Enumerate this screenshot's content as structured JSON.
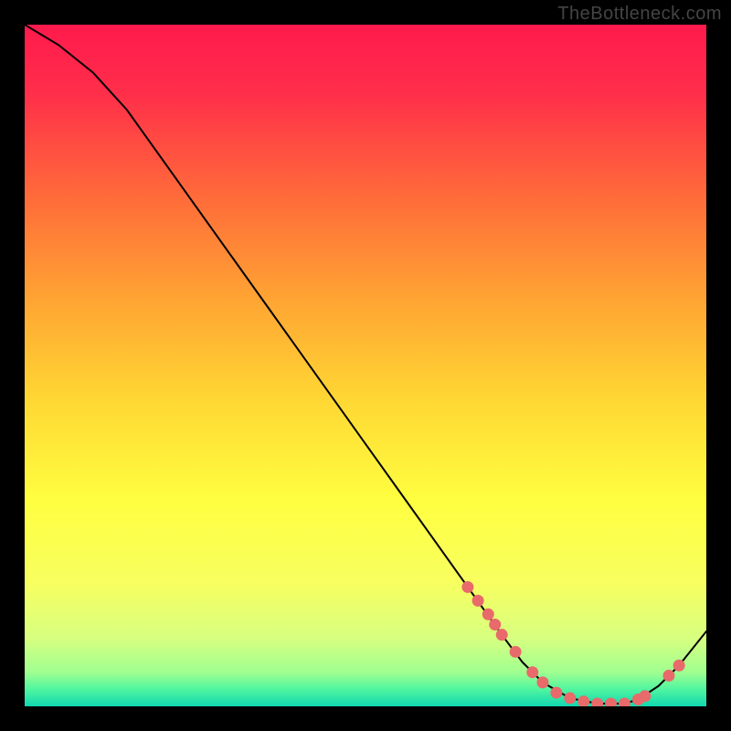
{
  "watermark": "TheBottleneck.com",
  "chart_data": {
    "type": "line",
    "title": "",
    "xlabel": "",
    "ylabel": "",
    "xlim": [
      0,
      100
    ],
    "ylim": [
      0,
      100
    ],
    "background_gradient": {
      "stops": [
        {
          "offset": 0.0,
          "color": "#ff1a4d"
        },
        {
          "offset": 0.1,
          "color": "#ff2e4a"
        },
        {
          "offset": 0.25,
          "color": "#ff6a3a"
        },
        {
          "offset": 0.4,
          "color": "#ffa333"
        },
        {
          "offset": 0.55,
          "color": "#ffd733"
        },
        {
          "offset": 0.7,
          "color": "#ffff40"
        },
        {
          "offset": 0.82,
          "color": "#f7ff60"
        },
        {
          "offset": 0.9,
          "color": "#d7ff80"
        },
        {
          "offset": 0.95,
          "color": "#a0ff90"
        },
        {
          "offset": 0.975,
          "color": "#50f5a0"
        },
        {
          "offset": 1.0,
          "color": "#10d8b0"
        }
      ]
    },
    "series": [
      {
        "name": "bottleneck-curve",
        "color": "#000000",
        "x": [
          0,
          5,
          10,
          15,
          20,
          25,
          30,
          35,
          40,
          45,
          50,
          55,
          60,
          65,
          70,
          73,
          76,
          80,
          84,
          88,
          90,
          93,
          96,
          100
        ],
        "y": [
          100,
          97,
          93,
          87.5,
          80.5,
          73.5,
          66.5,
          59.5,
          52.5,
          45.5,
          38.5,
          31.5,
          24.5,
          17.5,
          10.5,
          6.5,
          3.5,
          1.2,
          0.4,
          0.4,
          1.0,
          3.0,
          6.0,
          11
        ]
      }
    ],
    "markers": {
      "name": "highlight-dots",
      "color": "#e86a6a",
      "points": [
        {
          "x": 65.0,
          "y": 17.5
        },
        {
          "x": 66.5,
          "y": 15.5
        },
        {
          "x": 68.0,
          "y": 13.5
        },
        {
          "x": 69.0,
          "y": 12.0
        },
        {
          "x": 70.0,
          "y": 10.5
        },
        {
          "x": 72.0,
          "y": 8.0
        },
        {
          "x": 74.5,
          "y": 5.0
        },
        {
          "x": 76.0,
          "y": 3.5
        },
        {
          "x": 78.0,
          "y": 2.0
        },
        {
          "x": 80.0,
          "y": 1.2
        },
        {
          "x": 82.0,
          "y": 0.7
        },
        {
          "x": 84.0,
          "y": 0.4
        },
        {
          "x": 86.0,
          "y": 0.4
        },
        {
          "x": 88.0,
          "y": 0.4
        },
        {
          "x": 90.0,
          "y": 1.0
        },
        {
          "x": 91.0,
          "y": 1.5
        },
        {
          "x": 94.5,
          "y": 4.5
        },
        {
          "x": 96.0,
          "y": 6.0
        }
      ]
    }
  }
}
